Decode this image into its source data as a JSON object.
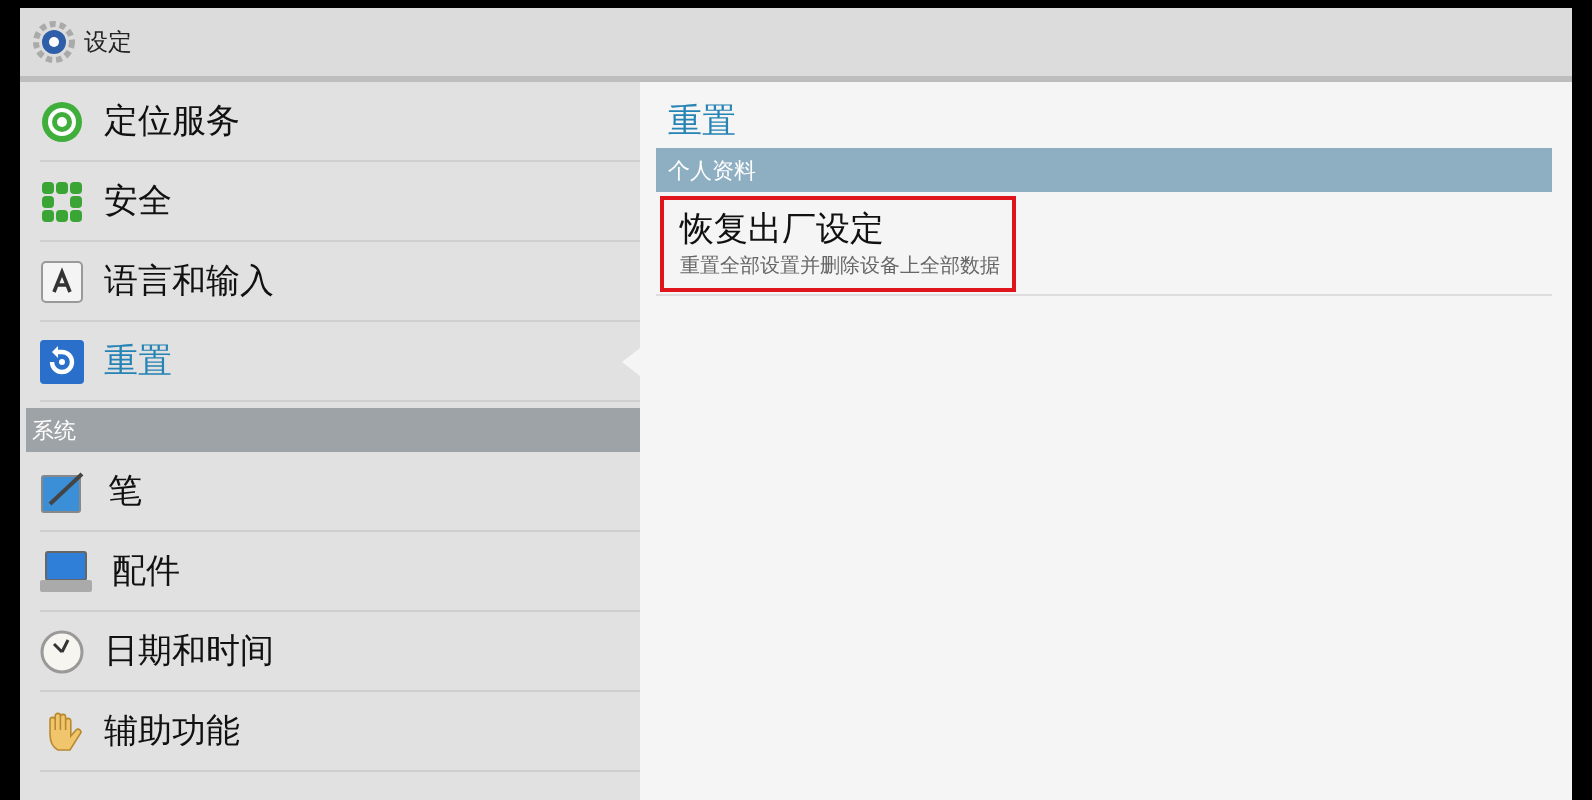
{
  "window": {
    "title": "设定"
  },
  "sidebar": {
    "sections": [
      {
        "items": [
          {
            "label": "定位服务",
            "selected": false
          },
          {
            "label": "安全",
            "selected": false
          },
          {
            "label": "语言和输入",
            "selected": false
          },
          {
            "label": "重置",
            "selected": true
          }
        ]
      },
      {
        "header": "系统",
        "items": [
          {
            "label": "笔",
            "selected": false
          },
          {
            "label": "配件",
            "selected": false
          },
          {
            "label": "日期和时间",
            "selected": false
          },
          {
            "label": "辅助功能",
            "selected": false
          }
        ]
      }
    ]
  },
  "detail": {
    "title": "重置",
    "category": "个人资料",
    "items": [
      {
        "title": "恢复出厂设定",
        "summary": "重置全部设置并删除设备上全部数据",
        "highlighted": true
      }
    ]
  }
}
